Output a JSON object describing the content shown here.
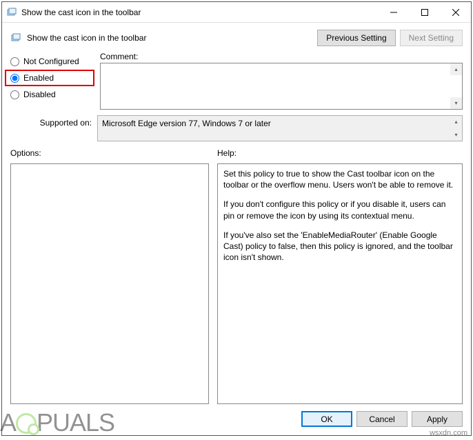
{
  "titlebar": {
    "title": "Show the cast icon in the toolbar"
  },
  "header": {
    "title": "Show the cast icon in the toolbar",
    "prev_label": "Previous Setting",
    "next_label": "Next Setting"
  },
  "config": {
    "not_configured_label": "Not Configured",
    "enabled_label": "Enabled",
    "disabled_label": "Disabled",
    "selected": "enabled",
    "comment_label": "Comment:",
    "comment_value": ""
  },
  "supported": {
    "label": "Supported on:",
    "value": "Microsoft Edge version 77, Windows 7 or later"
  },
  "options": {
    "label": "Options:"
  },
  "help": {
    "label": "Help:",
    "p1": "Set this policy to true to show the Cast toolbar icon on the toolbar or the overflow menu. Users won't be able to remove it.",
    "p2": "If you don't configure this policy or if you disable it, users can pin or remove the icon by using its contextual menu.",
    "p3": "If you've also set the 'EnableMediaRouter' (Enable Google Cast) policy to false, then this policy is ignored, and the toolbar icon isn't shown."
  },
  "footer": {
    "ok": "OK",
    "cancel": "Cancel",
    "apply": "Apply"
  },
  "watermark": {
    "text_before": "A",
    "text_after": "PUALS",
    "site": "wsxdn.com"
  }
}
